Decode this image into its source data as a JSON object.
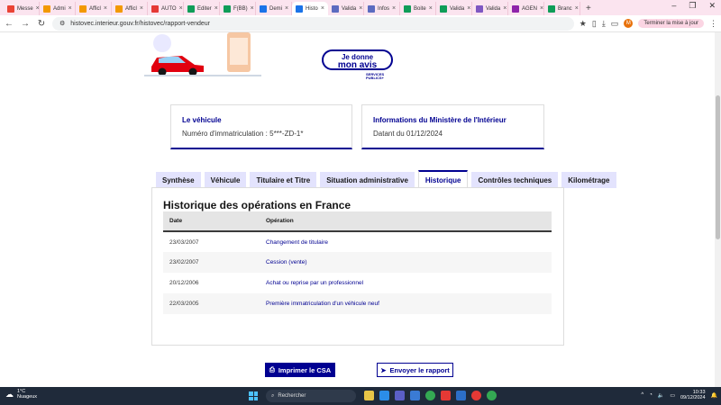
{
  "browser": {
    "tabs": [
      {
        "label": "Messe",
        "color": "#ea4335"
      },
      {
        "label": "Admi",
        "color": "#f29900"
      },
      {
        "label": "Afficl",
        "color": "#f29900"
      },
      {
        "label": "Afficl",
        "color": "#f29900"
      },
      {
        "label": "AUTO",
        "color": "#e53935"
      },
      {
        "label": "Editer",
        "color": "#0f9d58"
      },
      {
        "label": "F(BB)",
        "color": "#0f9d58"
      },
      {
        "label": "Demi",
        "color": "#1a73e8"
      },
      {
        "label": "Histo",
        "color": "#1a73e8",
        "active": true
      },
      {
        "label": "Valida",
        "color": "#5c6bc0"
      },
      {
        "label": "Infos",
        "color": "#5c6bc0"
      },
      {
        "label": "Boite",
        "color": "#0f9d58"
      },
      {
        "label": "Valida",
        "color": "#0f9d58"
      },
      {
        "label": "Valida",
        "color": "#7e57c2"
      },
      {
        "label": "AGEN",
        "color": "#8e24aa"
      },
      {
        "label": "Branc",
        "color": "#0f9d58"
      }
    ],
    "url": "histovec.interieur.gouv.fr/histovec/rapport-vendeur",
    "update_label": "Terminer la mise à jour",
    "profile_initial": "M"
  },
  "page": {
    "feedback": {
      "line1": "Je donne",
      "line2": "mon avis",
      "badge_line1": "SERVICES",
      "badge_line2": "PUBLICS+"
    },
    "card_vehicle": {
      "title": "Le véhicule",
      "value": "Numéro d'immatriculation : 5***-ZD-1*"
    },
    "card_ministry": {
      "title": "Informations du Ministère de l'Intérieur",
      "value": "Datant du 01/12/2024"
    },
    "tabs": [
      "Synthèse",
      "Véhicule",
      "Titulaire et Titre",
      "Situation administrative",
      "Historique",
      "Contrôles techniques",
      "Kilométrage"
    ],
    "active_tab": "Historique",
    "history": {
      "title": "Historique des opérations en France",
      "col_date": "Date",
      "col_operation": "Opération",
      "rows": [
        {
          "date": "23/03/2007",
          "operation": "Changement de titulaire"
        },
        {
          "date": "23/02/2007",
          "operation": "Cession (vente)"
        },
        {
          "date": "20/12/2006",
          "operation": "Achat ou reprise par un professionnel"
        },
        {
          "date": "22/03/2005",
          "operation": "Première immatriculation d'un véhicule neuf"
        }
      ]
    },
    "print_button": "Imprimer le CSA",
    "send_button": "Envoyer le rapport"
  },
  "taskbar": {
    "weather_temp": "1°C",
    "weather_desc": "Nuageux",
    "search_placeholder": "Rechercher",
    "time": "10:33",
    "date": "09/12/2024"
  },
  "colors": {
    "accent": "#000091",
    "tab_bg": "#e3e3fd"
  }
}
